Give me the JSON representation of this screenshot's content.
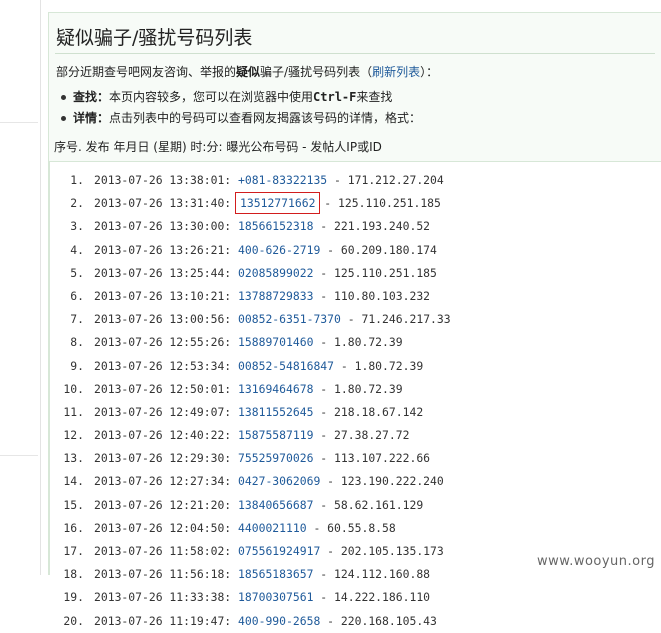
{
  "title": "疑似骗子/骚扰号码列表",
  "intro": {
    "prefix": "部分近期查号吧网友咨询、举报的",
    "bold": "疑似",
    "middle": "骗子/骚扰号码列表（",
    "link": "刷新列表",
    "suffix": "）："
  },
  "tips": [
    {
      "keyword": "查找：",
      "text_before": "本页内容较多，您可以在浏览器中使用",
      "mono": "Ctrl-F",
      "text_after": "来查找"
    },
    {
      "keyword": "详情：",
      "text_before": "点击列表中的号码可以查看网友揭露该号码的详情，格式：",
      "mono": "",
      "text_after": ""
    }
  ],
  "list_header": "序号. 发布 年月日 (星期) 时:分: 曝光公布号码 - 发帖人IP或ID",
  "rows": [
    {
      "idx": "1.",
      "time": "2013-07-26 13:38:01:",
      "phone": "+081-83322135",
      "ip": "171.212.27.204"
    },
    {
      "idx": "2.",
      "time": "2013-07-26 13:31:40:",
      "phone": "13512771662",
      "ip": "125.110.251.185",
      "highlight": true
    },
    {
      "idx": "3.",
      "time": "2013-07-26 13:30:00:",
      "phone": "18566152318",
      "ip": "221.193.240.52"
    },
    {
      "idx": "4.",
      "time": "2013-07-26 13:26:21:",
      "phone": "400-626-2719",
      "ip": "60.209.180.174"
    },
    {
      "idx": "5.",
      "time": "2013-07-26 13:25:44:",
      "phone": "02085899022",
      "ip": "125.110.251.185"
    },
    {
      "idx": "6.",
      "time": "2013-07-26 13:10:21:",
      "phone": "13788729833",
      "ip": "110.80.103.232"
    },
    {
      "idx": "7.",
      "time": "2013-07-26 13:00:56:",
      "phone": "00852-6351-7370",
      "ip": "71.246.217.33"
    },
    {
      "idx": "8.",
      "time": "2013-07-26 12:55:26:",
      "phone": "15889701460",
      "ip": "1.80.72.39"
    },
    {
      "idx": "9.",
      "time": "2013-07-26 12:53:34:",
      "phone": "00852-54816847",
      "ip": "1.80.72.39"
    },
    {
      "idx": "10.",
      "time": "2013-07-26 12:50:01:",
      "phone": "13169464678",
      "ip": "1.80.72.39"
    },
    {
      "idx": "11.",
      "time": "2013-07-26 12:49:07:",
      "phone": "13811552645",
      "ip": "218.18.67.142"
    },
    {
      "idx": "12.",
      "time": "2013-07-26 12:40:22:",
      "phone": "15875587119",
      "ip": "27.38.27.72"
    },
    {
      "idx": "13.",
      "time": "2013-07-26 12:29:30:",
      "phone": "75525970026",
      "ip": "113.107.222.66"
    },
    {
      "idx": "14.",
      "time": "2013-07-26 12:27:34:",
      "phone": "0427-3062069",
      "ip": "123.190.222.240"
    },
    {
      "idx": "15.",
      "time": "2013-07-26 12:21:20:",
      "phone": "13840656687",
      "ip": "58.62.161.129"
    },
    {
      "idx": "16.",
      "time": "2013-07-26 12:04:50:",
      "phone": "4400021110",
      "ip": "60.55.8.58"
    },
    {
      "idx": "17.",
      "time": "2013-07-26 11:58:02:",
      "phone": "075561924917",
      "ip": "202.105.135.173"
    },
    {
      "idx": "18.",
      "time": "2013-07-26 11:56:18:",
      "phone": "18565183657",
      "ip": "124.112.160.88"
    },
    {
      "idx": "19.",
      "time": "2013-07-26 11:33:38:",
      "phone": "18700307561",
      "ip": "14.222.186.110"
    },
    {
      "idx": "20.",
      "time": "2013-07-26 11:19:47:",
      "phone": "400-990-2658",
      "ip": "220.168.105.43"
    }
  ],
  "separator": " - ",
  "watermark": "www.wooyun.org",
  "colors": {
    "link": "#1f5a9a",
    "highlight_box": "#d21d1d",
    "panel_bg": "#f7fbf7"
  }
}
